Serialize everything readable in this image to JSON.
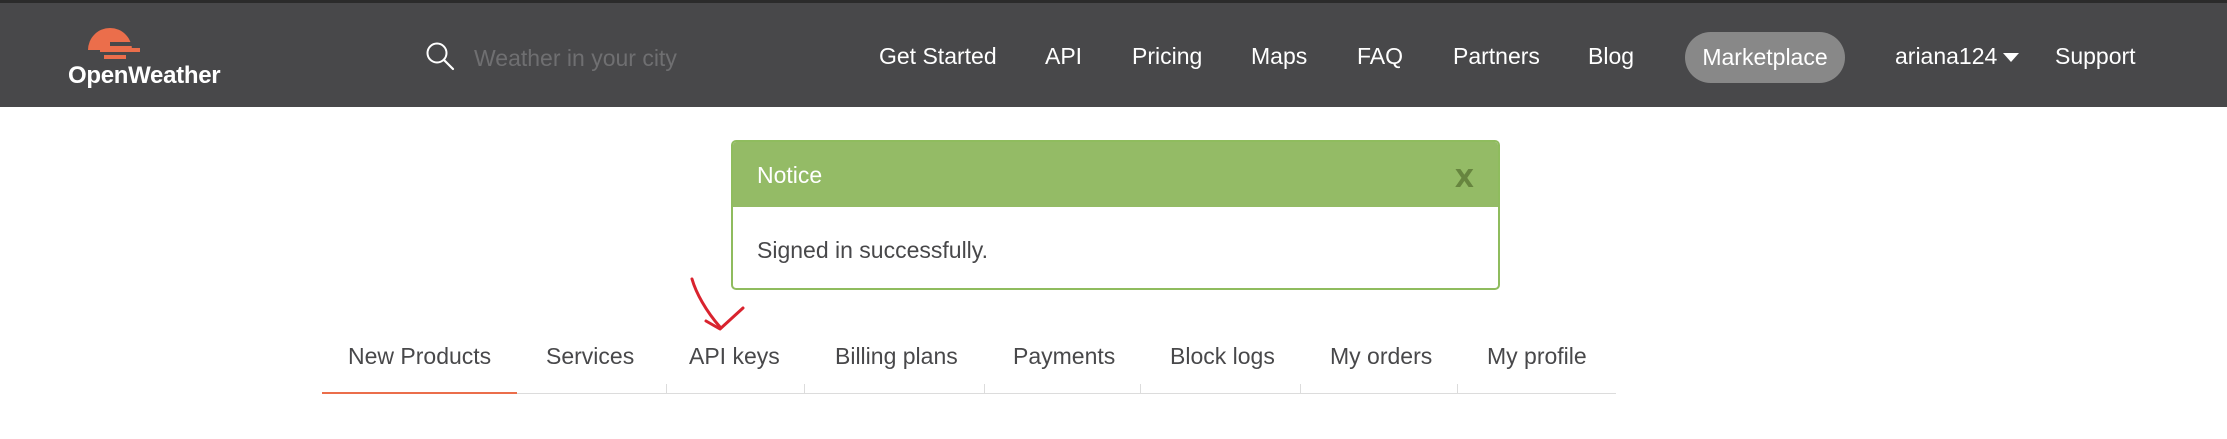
{
  "brand": {
    "name": "OpenWeather",
    "logo_icon": "sun-logo-icon",
    "accent_color": "#eb6e4b"
  },
  "search": {
    "placeholder": "Weather in your city",
    "icon": "search-icon"
  },
  "nav": {
    "items": [
      "Get Started",
      "API",
      "Pricing",
      "Maps",
      "FAQ",
      "Partners",
      "Blog"
    ],
    "marketplace": "Marketplace",
    "user": "ariana124",
    "support": "Support"
  },
  "notice": {
    "title": "Notice",
    "close": "X",
    "message": "Signed in successfully.",
    "color": "#94bb66"
  },
  "tabs": {
    "items": [
      "New Products",
      "Services",
      "API keys",
      "Billing plans",
      "Payments",
      "Block logs",
      "My orders",
      "My profile"
    ],
    "active": "New Products"
  },
  "annotation": {
    "icon": "red-arrow-annotation-icon",
    "color": "#d9232e"
  }
}
